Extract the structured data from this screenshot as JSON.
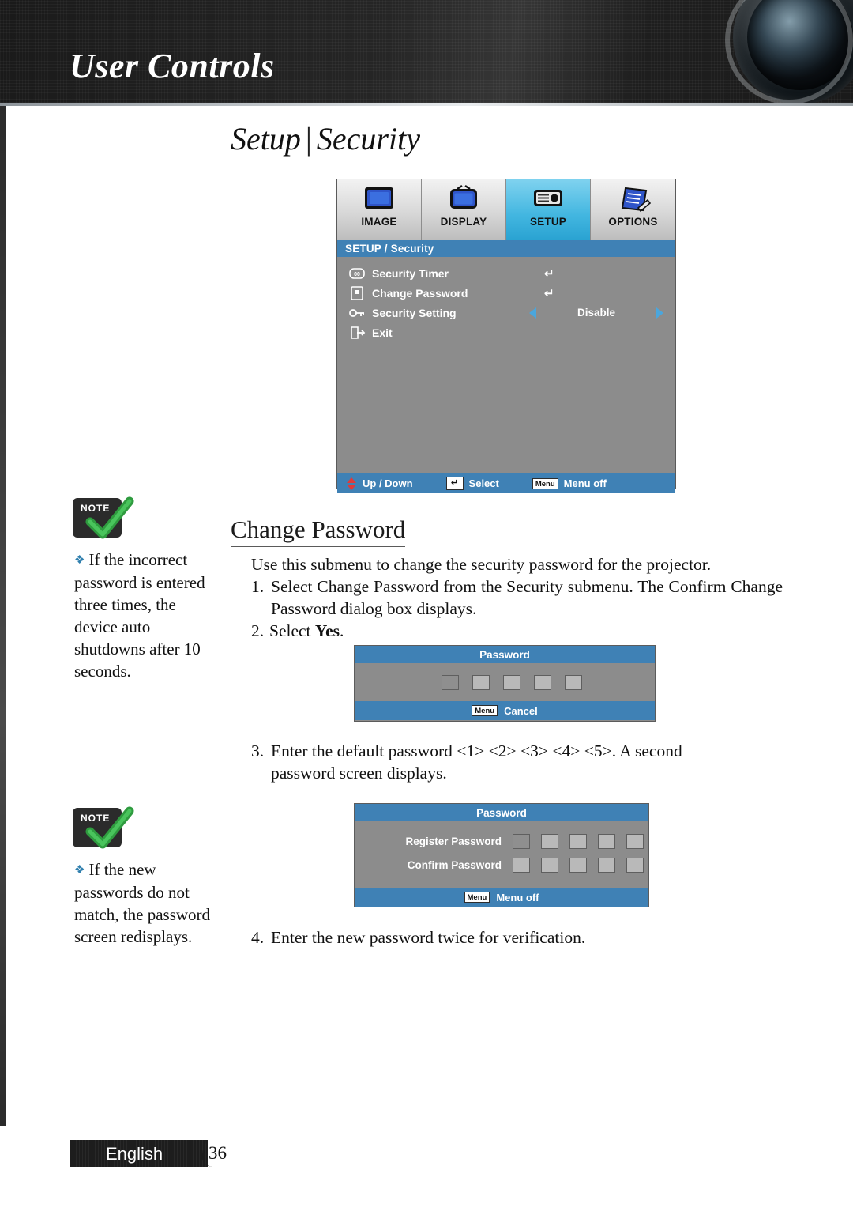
{
  "header": {
    "title": "User Controls",
    "lens_icon": "camera-lens-icon"
  },
  "page_title": {
    "left": "Setup",
    "separator": "|",
    "right": "Security"
  },
  "osd_menu": {
    "tabs": [
      {
        "label": "IMAGE",
        "icon": "image-icon",
        "active": false
      },
      {
        "label": "DISPLAY",
        "icon": "display-tv-icon",
        "active": false
      },
      {
        "label": "SETUP",
        "icon": "setup-slider-icon",
        "active": true
      },
      {
        "label": "OPTIONS",
        "icon": "options-clipboard-icon",
        "active": false
      }
    ],
    "breadcrumb": "SETUP / Security",
    "rows": [
      {
        "label": "Security Timer",
        "icon": "timer-icon",
        "control": "enter",
        "enter_glyph": "↵"
      },
      {
        "label": "Change Password",
        "icon": "password-icon",
        "control": "enter",
        "enter_glyph": "↵"
      },
      {
        "label": "Security Setting",
        "icon": "key-icon",
        "control": "value",
        "value": "Disable"
      },
      {
        "label": "Exit",
        "icon": "exit-icon",
        "control": "none"
      }
    ],
    "footer": {
      "updown": "Up / Down",
      "select": "Select",
      "menu_key": "Menu",
      "menu_off": "Menu off"
    }
  },
  "notes": [
    {
      "badge": "NOTE",
      "text": "If the incorrect password is entered three times, the device auto shutdowns after 10 seconds."
    },
    {
      "badge": "NOTE",
      "text": "If the new passwords do not match, the password screen redisplays."
    }
  ],
  "section": {
    "heading": "Change Password",
    "intro": "Use this submenu to change the security password for the projector.",
    "step1_num": "1.",
    "step1": "Select Change Password from the Security submenu. The Confirm Change Password dialog box displays.",
    "step2_num": "2.",
    "step2_prefix": "Select ",
    "step2_bold": "Yes",
    "step2_suffix": ".",
    "step3_num": "3.",
    "step3": "Enter the default password <1> <2> <3> <4> <5>. A second password screen displays.",
    "step4_num": "4.",
    "step4": "Enter the new password twice for verification."
  },
  "password_dialog_1": {
    "title": "Password",
    "boxes": 5,
    "menu_key": "Menu",
    "cancel": "Cancel"
  },
  "password_dialog_2": {
    "title": "Password",
    "register_label": "Register Password",
    "confirm_label": "Confirm Password",
    "boxes": 5,
    "menu_key": "Menu",
    "menu_off": "Menu off"
  },
  "footer": {
    "language": "English",
    "page_number": "36"
  },
  "colors": {
    "osd_title_bar": "#3f81b5",
    "osd_body": "#8c8c8c",
    "tab_active": "#42b6e0",
    "note_diamond": "#2f7fae",
    "header_band": "#1a1a1a"
  }
}
